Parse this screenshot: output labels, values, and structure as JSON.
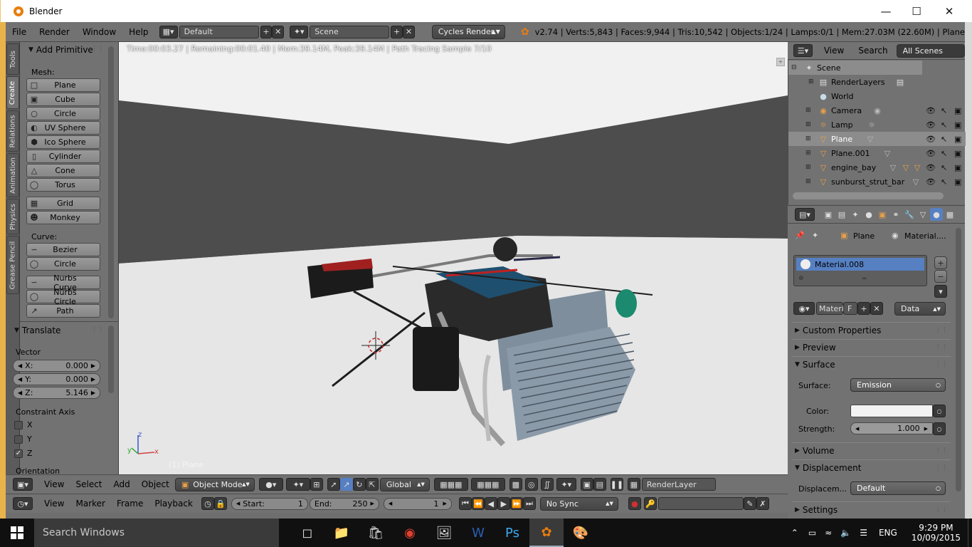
{
  "window": {
    "title": "Blender",
    "minimize_icon": "minimize-icon",
    "maximize_icon": "maximize-icon",
    "close_icon": "close-icon"
  },
  "menu": {
    "items": [
      "File",
      "Render",
      "Window",
      "Help"
    ],
    "screen_layout": "Default",
    "scene": "Scene",
    "render_engine": "Cycles Render",
    "stats": "v2.74 | Verts:5,843 | Faces:9,944 | Tris:10,542 | Objects:1/24 | Lamps:0/1 | Mem:27.03M (22.60M) | Plane"
  },
  "tool_tabs": [
    "Tools",
    "Create",
    "Relations",
    "Animation",
    "Physics",
    "Grease Pencil"
  ],
  "add_primitive": {
    "title": "Add Primitive",
    "mesh_label": "Mesh:",
    "mesh": [
      "Plane",
      "Cube",
      "Circle",
      "UV Sphere",
      "Ico Sphere",
      "Cylinder",
      "Cone",
      "Torus",
      "Grid",
      "Monkey"
    ],
    "curve_label": "Curve:",
    "curve": [
      "Bezier",
      "Circle",
      "Nurbs Curve",
      "Nurbs Circle",
      "Path"
    ]
  },
  "translate": {
    "title": "Translate",
    "vector_label": "Vector",
    "x_label": "X:",
    "x": "0.000",
    "y_label": "Y:",
    "y": "0.000",
    "z_label": "Z:",
    "z": "5.146",
    "constraint_label": "Constraint Axis",
    "axes": [
      "X",
      "Y",
      "Z"
    ],
    "axes_checked": [
      false,
      false,
      true
    ],
    "orientation_label": "Orientation"
  },
  "viewport": {
    "render_info": "Time:00:03.27 | Remaining:00:01.40 | Mem:39.14M, Peak:39.14M | Path Tracing Sample 7/10",
    "object_label": "(1) Plane",
    "axis_x": "x",
    "axis_y": "y",
    "axis_z": "z"
  },
  "view3d_header": {
    "items": [
      "View",
      "Select",
      "Add",
      "Object"
    ],
    "mode": "Object Mode",
    "orientation": "Global",
    "render_layer": "RenderLayer"
  },
  "timeline": {
    "items": [
      "View",
      "Marker",
      "Frame",
      "Playback"
    ],
    "start_label": "Start:",
    "start": "1",
    "end_label": "End:",
    "end": "250",
    "current": "1",
    "sync": "No Sync"
  },
  "outliner": {
    "header": [
      "View",
      "Search"
    ],
    "filter": "All Scenes",
    "rows": [
      "Scene",
      "RenderLayers",
      "World",
      "Camera",
      "Lamp",
      "Plane",
      "Plane.001",
      "engine_bay",
      "sunburst_strut_bar"
    ]
  },
  "properties": {
    "breadcrumb": [
      "Plane",
      "Material...."
    ],
    "material_slot": "Material.008",
    "material_name": "Materi",
    "fake_user": "F",
    "link": "Data",
    "sections": [
      "Custom Properties",
      "Preview",
      "Surface",
      "Volume",
      "Displacement",
      "Settings"
    ],
    "surface_label": "Surface:",
    "surface": "Emission",
    "color_label": "Color:",
    "strength_label": "Strength:",
    "strength": "1.000",
    "displacement_label": "Displacem...",
    "displacement": "Default",
    "colors": {
      "selection": "#5680c2",
      "color_swatch": "#f2f2f2"
    }
  },
  "taskbar": {
    "search": "Search Windows",
    "lang": "ENG",
    "time": "9:29 PM",
    "date": "10/09/2015"
  }
}
